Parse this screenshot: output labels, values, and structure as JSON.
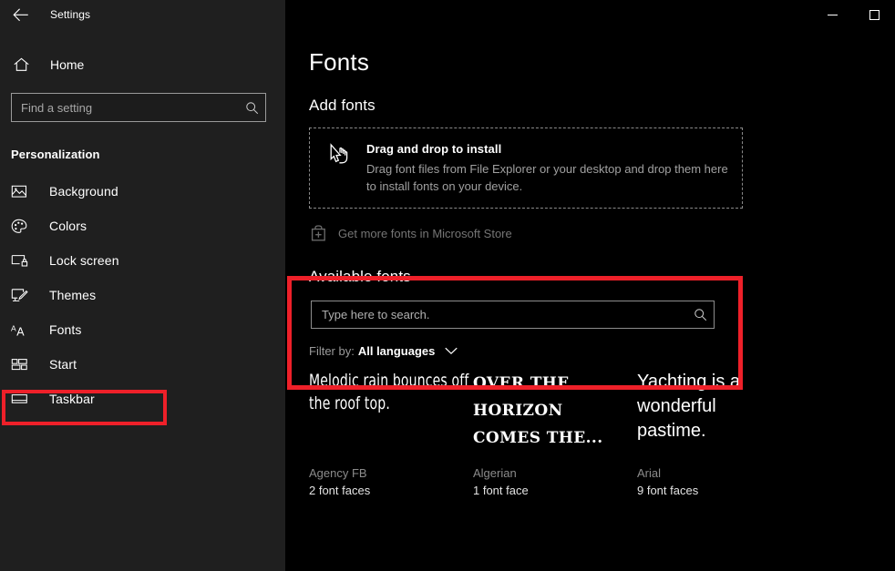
{
  "window": {
    "title": "Settings",
    "back_icon": "back-arrow-icon",
    "minimize_label": "Minimize",
    "maximize_label": "Maximize"
  },
  "sidebar": {
    "home_label": "Home",
    "home_icon": "home-icon",
    "search": {
      "placeholder": "Find a setting",
      "value": "",
      "icon": "search-icon"
    },
    "section_label": "Personalization",
    "items": [
      {
        "label": "Background",
        "icon": "image-icon",
        "selected": false
      },
      {
        "label": "Colors",
        "icon": "palette-icon",
        "selected": false
      },
      {
        "label": "Lock screen",
        "icon": "lock-screen-icon",
        "selected": false
      },
      {
        "label": "Themes",
        "icon": "themes-brush-icon",
        "selected": false
      },
      {
        "label": "Fonts",
        "icon": "fonts-aa-icon",
        "selected": true
      },
      {
        "label": "Start",
        "icon": "start-grid-icon",
        "selected": false
      },
      {
        "label": "Taskbar",
        "icon": "taskbar-icon",
        "selected": false
      }
    ]
  },
  "main": {
    "page_title": "Fonts",
    "add_fonts_heading": "Add fonts",
    "dropzone": {
      "icon": "drag-hand-cursor-icon",
      "title": "Drag and drop to install",
      "description": "Drag font files from File Explorer or your desktop and drop them here to install fonts on your device."
    },
    "store_link": {
      "icon": "microsoft-store-bag-icon",
      "label": "Get more fonts in Microsoft Store"
    },
    "available_heading": "Available fonts",
    "font_search": {
      "placeholder": "Type here to search.",
      "value": "",
      "icon": "search-icon"
    },
    "filter": {
      "label": "Filter by:",
      "value": "All languages",
      "chevron_icon": "chevron-down-icon"
    },
    "font_cards": [
      {
        "preview": "Melodic rain bounces off the roof top.",
        "name": "Agency FB",
        "faces": "2 font faces"
      },
      {
        "preview": "Over the horizon comes the...",
        "name": "Algerian",
        "faces": "1 font face"
      },
      {
        "preview": "Yachting is a wonderful pastime.",
        "name": "Arial",
        "faces": "9 font faces"
      }
    ]
  },
  "annotations": {
    "highlight_color": "#ee2029",
    "boxes": [
      "sidebar-fonts-item",
      "available-fonts-section"
    ]
  }
}
